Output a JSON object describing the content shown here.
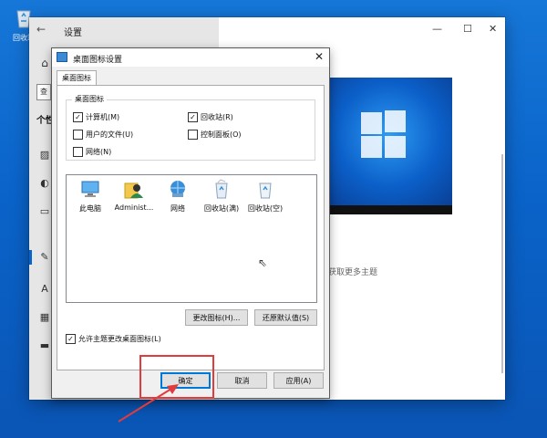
{
  "desktop": {
    "recycle_bin_label": "回收站"
  },
  "settings": {
    "title": "设置",
    "back_glyph": "←",
    "minimize_glyph": "—",
    "maximize_glyph": "☐",
    "close_glyph": "✕",
    "search_fragment": "查",
    "section_fragment": "个性",
    "get_more_themes": "获取更多主题"
  },
  "dialog": {
    "title": "桌面图标设置",
    "close_glyph": "✕",
    "tab_label": "桌面图标",
    "group_label": "桌面图标",
    "checkboxes": [
      {
        "label": "计算机(M)",
        "checked": true
      },
      {
        "label": "回收站(R)",
        "checked": true
      },
      {
        "label": "用户的文件(U)",
        "checked": false
      },
      {
        "label": "控制面板(O)",
        "checked": false
      },
      {
        "label": "网络(N)",
        "checked": false
      }
    ],
    "icons": [
      {
        "label": "此电脑",
        "icon": "monitor-icon"
      },
      {
        "label": "Administ...",
        "icon": "user-icon"
      },
      {
        "label": "网络",
        "icon": "network-icon"
      },
      {
        "label": "回收站(满)",
        "icon": "recycle-bin-full-icon"
      },
      {
        "label": "回收站(空)",
        "icon": "recycle-bin-empty-icon"
      }
    ],
    "change_icon_button": "更改图标(H)...",
    "restore_default_button": "还原默认值(S)",
    "allow_themes_checkbox": {
      "label": "允许主题更改桌面图标(L)",
      "checked": true
    },
    "ok_button": "确定",
    "cancel_button": "取消",
    "apply_button": "应用(A)"
  },
  "colors": {
    "annotation": "#e23b3b",
    "accent": "#0078d7",
    "desktop": "#0a63c9"
  }
}
